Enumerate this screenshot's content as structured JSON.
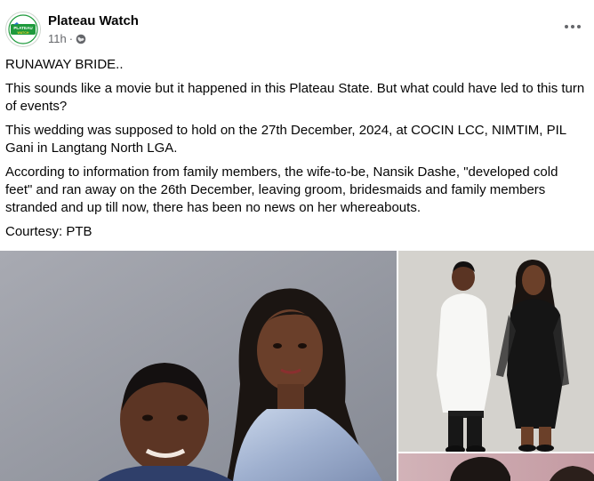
{
  "post": {
    "page_name": "Plateau Watch",
    "time": "11h",
    "separator": "·",
    "avatar_text_top": "PLATEAU",
    "avatar_text_bottom": "WATCH",
    "privacy_icon": "globe-icon",
    "more_icon": "more-options-icon",
    "paragraphs": [
      "RUNAWAY BRIDE..",
      "This sounds like a movie but it happened in this Plateau State. But what could have led to this turn of events?",
      "This wedding was supposed to hold on the 27th December, 2024, at COCIN LCC, NIMTIM, PIL Gani in Langtang North LGA.",
      "According to information from family members, the wife-to-be, Nansik Dashe, \"developed cold feet\" and ran away on the 26th December, leaving groom, bridesmaids and family members stranded and up till now, there has been no news on her whereabouts.",
      "Courtesy: PTB"
    ]
  },
  "colors": {
    "text": "#050505",
    "secondary_text": "#65676b",
    "avatar_green": "#1e9a3c",
    "photo_backdrop": "#9a9da6"
  }
}
